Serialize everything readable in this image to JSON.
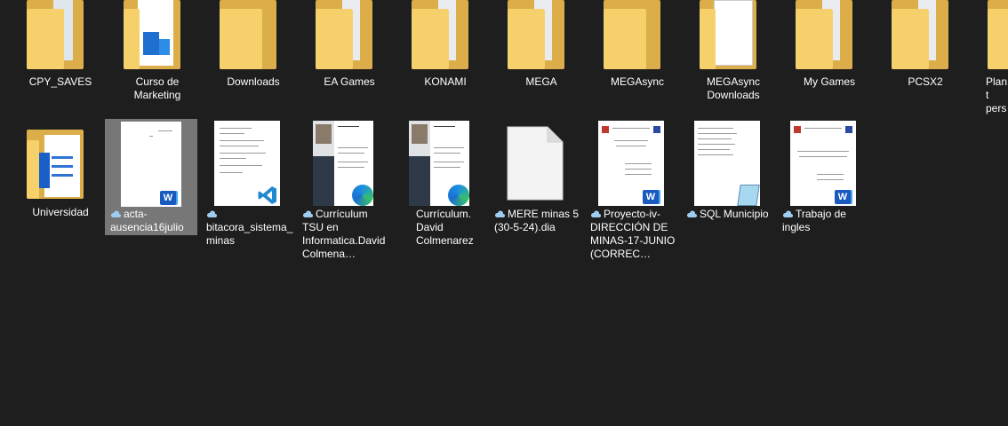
{
  "row1": [
    {
      "label": "CPY_SAVES",
      "icon": "folder-icon"
    },
    {
      "label": "Curso de Marketing",
      "icon": "folder-with-image-icon"
    },
    {
      "label": "Downloads",
      "icon": "folder-icon"
    },
    {
      "label": "EA Games",
      "icon": "folder-icon"
    },
    {
      "label": "KONAMI",
      "icon": "folder-icon"
    },
    {
      "label": "MEGA",
      "icon": "folder-icon"
    },
    {
      "label": "MEGAsync",
      "icon": "folder-icon"
    },
    {
      "label": "MEGAsync Downloads",
      "icon": "folder-with-page-icon"
    },
    {
      "label": "My Games",
      "icon": "folder-icon"
    },
    {
      "label": "PCSX2",
      "icon": "folder-icon"
    },
    {
      "label": "Plant pers de O",
      "icon": "folder-icon"
    }
  ],
  "row2": [
    {
      "label": "Universidad",
      "icon": "folder-with-word-icon",
      "cloud": false
    },
    {
      "label": "acta-ausencia16julio",
      "icon": "word-doc-thumbnail",
      "cloud": true,
      "selected": true
    },
    {
      "label": "bitacora_sistema_minas",
      "icon": "vscode-doc-thumbnail",
      "cloud": true
    },
    {
      "label": "Currículum TSU en Informatica.David Colmena…",
      "icon": "edge-pdf-thumbnail",
      "cloud": true
    },
    {
      "label": "Currículum. David Colmenarez",
      "icon": "edge-pdf-thumbnail",
      "cloud": false
    },
    {
      "label": "MERE minas 5 (30-5-24).dia",
      "icon": "blank-file-icon",
      "cloud": true
    },
    {
      "label": "Proyecto-iv-DIRECCIÓN DE MINAS-17-JUNIO (CORREC…",
      "icon": "word-doc-thumbnail",
      "cloud": true
    },
    {
      "label": "SQL Municipio",
      "icon": "notepad-doc-thumbnail",
      "cloud": true
    },
    {
      "label": "Trabajo de ingles",
      "icon": "word-doc-thumbnail",
      "cloud": true
    }
  ],
  "colors": {
    "background": "#1e1e1e",
    "folder": "#f6d06b",
    "selection": "#777777",
    "word": "#185abd",
    "cloud": "#9ecbf0"
  }
}
